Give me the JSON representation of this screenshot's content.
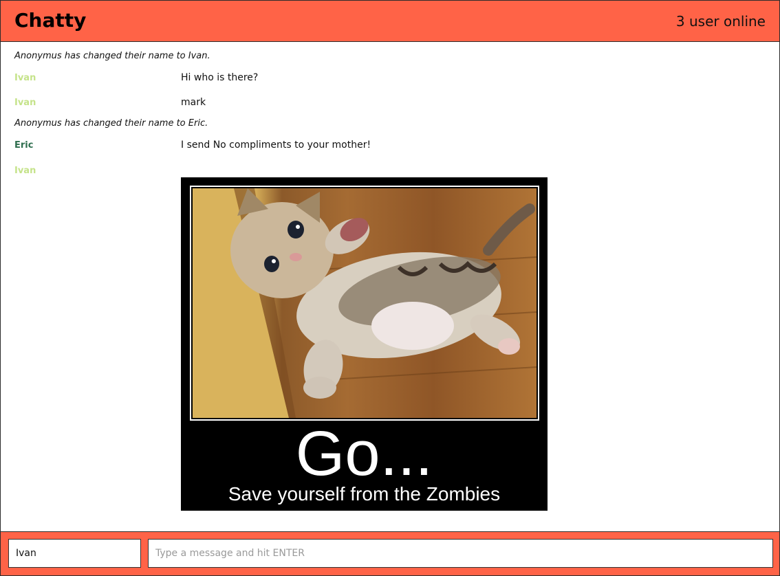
{
  "header": {
    "title": "Chatty",
    "online_status": "3 user online"
  },
  "messages": [
    {
      "type": "notice",
      "text": "Anonymus has changed their name to Ivan."
    },
    {
      "type": "text",
      "author": "Ivan",
      "text": "Hi who is there?"
    },
    {
      "type": "text",
      "author": "Ivan",
      "text": "mark"
    },
    {
      "type": "notice",
      "text": "Anonymus has changed their name to Eric."
    },
    {
      "type": "text",
      "author": "Eric",
      "text": "I send No compliments to your mother!"
    },
    {
      "type": "image",
      "author": "Ivan",
      "image": {
        "subject": "kitten-photo",
        "caption_big": "Go...",
        "caption_small": "Save yourself from the Zombies"
      }
    }
  ],
  "colors": {
    "accent": "#ff6347",
    "author_ivan": "#c5e38a",
    "author_eric": "#2e6e4e"
  },
  "composer": {
    "name_value": "Ivan",
    "message_value": "",
    "message_placeholder": "Type a message and hit ENTER"
  }
}
